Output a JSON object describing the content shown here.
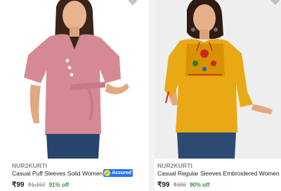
{
  "products": [
    {
      "brand": "NUR2KURTI",
      "title": "Casual Puff Sleeves Solid Women ...",
      "assured_label": "Assured",
      "price": "₹99",
      "mrp": "₹1,197",
      "discount": "91% off",
      "image": "pink-top-model-photo",
      "colors": {
        "top": "#d58a93",
        "jeans": "#27456f"
      }
    },
    {
      "brand": "NUR2KURTI",
      "title": "Casual Regular Sleeves Embroidered Women Y...",
      "price": "₹99",
      "mrp": "₹999",
      "discount": "90% off",
      "image": "yellow-embroidered-top-model-photo",
      "colors": {
        "top": "#e8a914",
        "jeans": "#2c4a72"
      }
    }
  ],
  "icons": {
    "wishlist": "heart-icon",
    "assured": "flipkart-assured-badge"
  },
  "colors": {
    "discount": "#388e3c",
    "assured": "#2874f0",
    "background": "#f1f3f6"
  }
}
